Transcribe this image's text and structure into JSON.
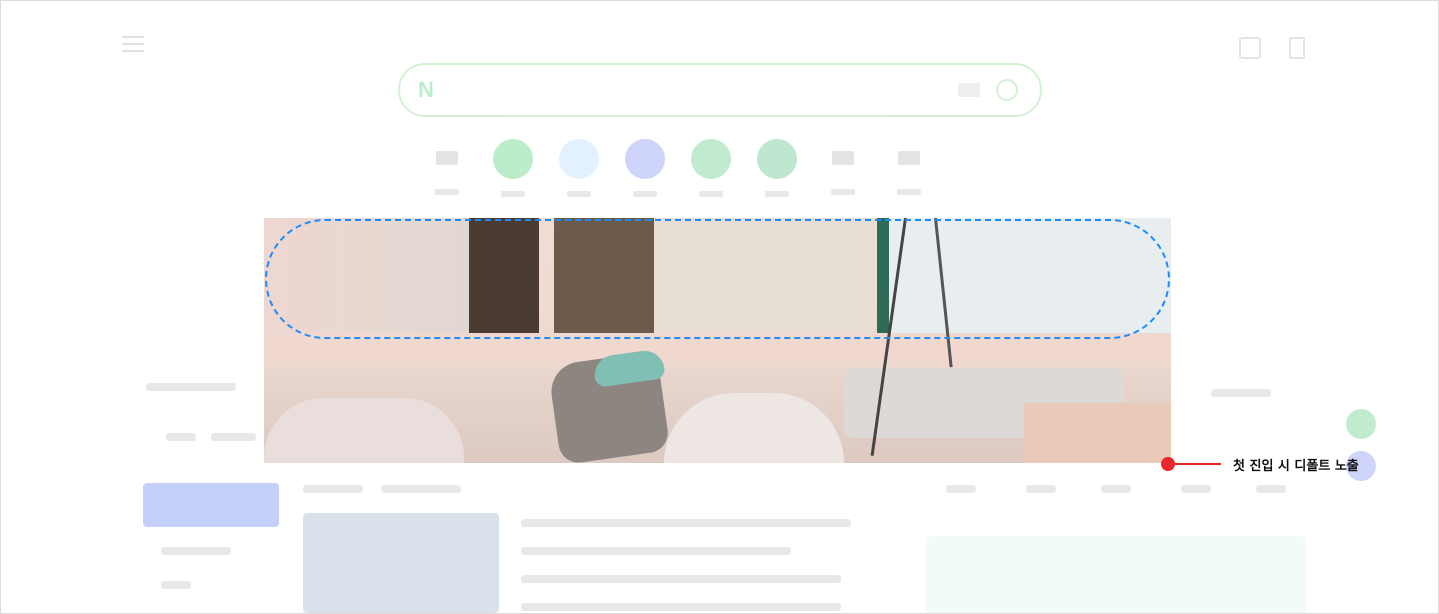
{
  "annotation": {
    "label": "첫 진입 시 디폴트 노출",
    "color": "#e8262b"
  },
  "search": {
    "logo": "N",
    "accent": "#2fc85c"
  },
  "highlight_color": "#1a8cff"
}
